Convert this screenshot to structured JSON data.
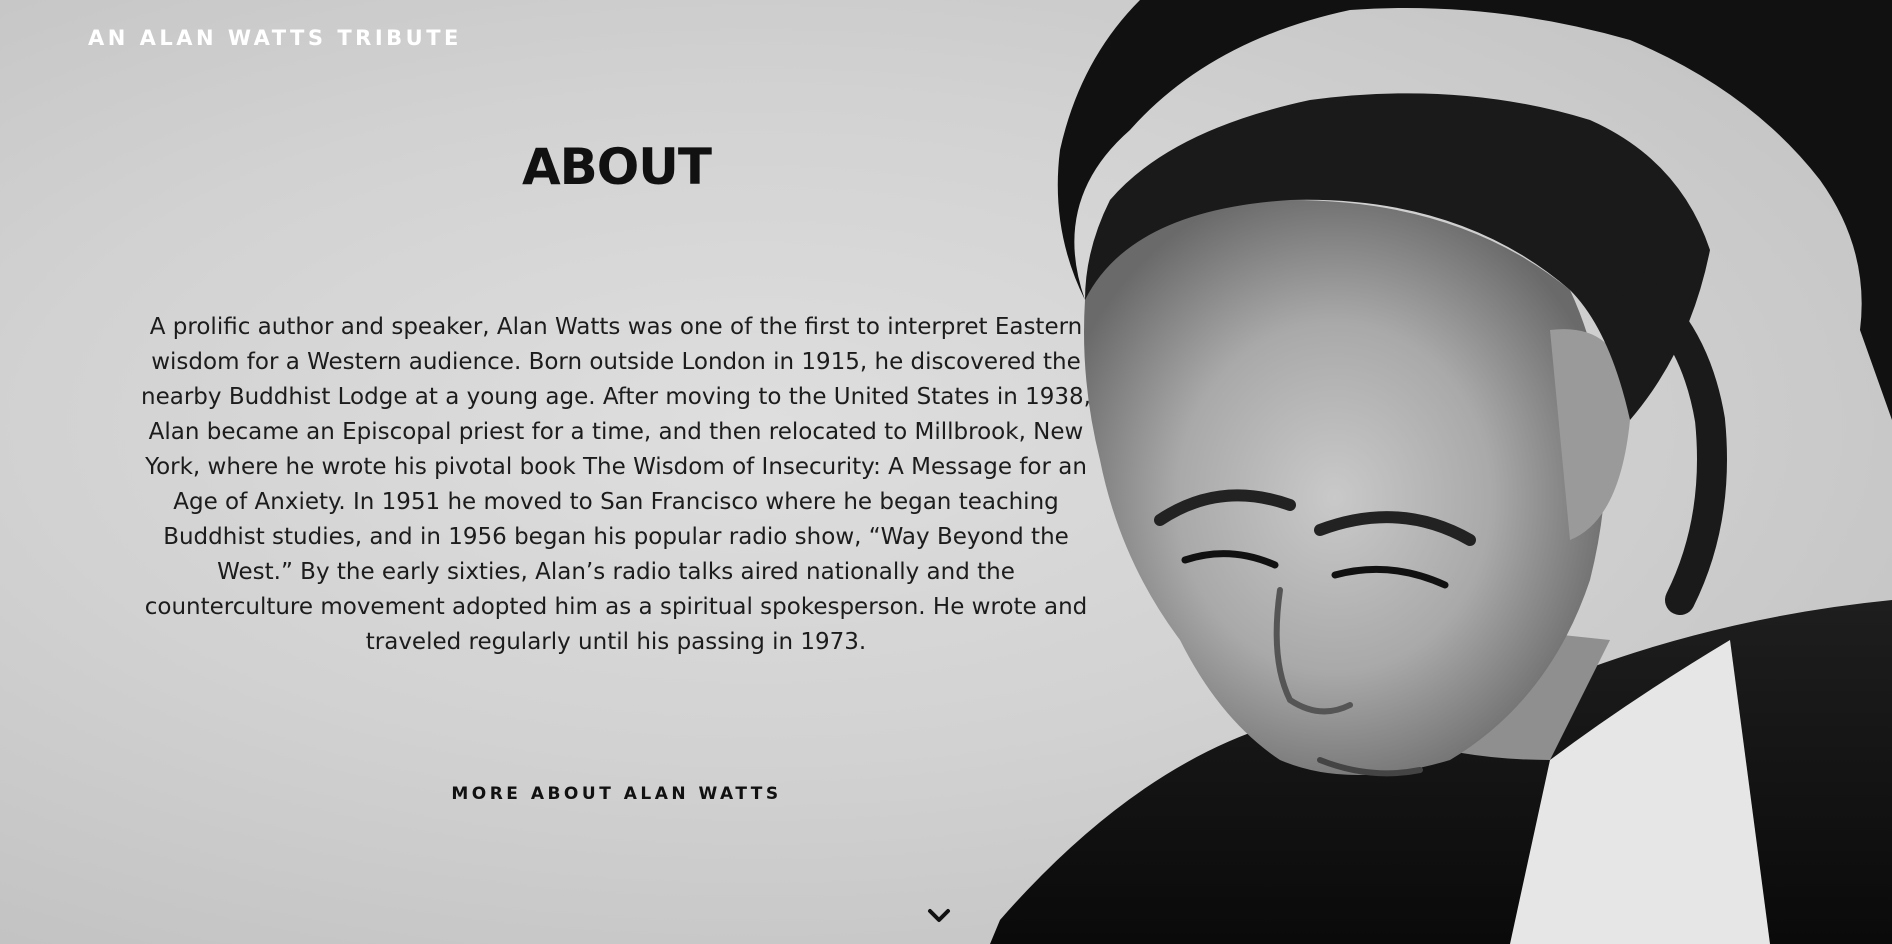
{
  "header": {
    "site_title": "AN ALAN WATTS TRIBUTE"
  },
  "about": {
    "title": "ABOUT",
    "bio": "A prolific author and speaker, Alan Watts was one of the first to interpret Eastern wisdom for a Western audience. Born outside London in 1915, he discovered the nearby Buddhist Lodge at a young age. After moving to the United States in 1938, Alan became an Episcopal priest for a time, and then relocated to Millbrook, New York, where he wrote his pivotal book The Wisdom of Insecurity: A Message for an Age of Anxiety. In 1951 he moved to San Francisco where he began teaching Buddhist studies, and in 1956 began his popular radio show, “Way Beyond the West.” By the early sixties, Alan’s radio talks aired nationally and the counterculture movement adopted him as a spiritual spokesperson. He wrote and traveled regularly until his passing in 1973.",
    "more_link": "MORE ABOUT ALAN WATTS"
  },
  "icons": {
    "scroll_up": "chevron-up-icon",
    "scroll_down": "chevron-down-icon"
  },
  "colors": {
    "background": "#d4d4d4",
    "title_text": "#ffffff",
    "body_text": "#1c1c1c"
  }
}
